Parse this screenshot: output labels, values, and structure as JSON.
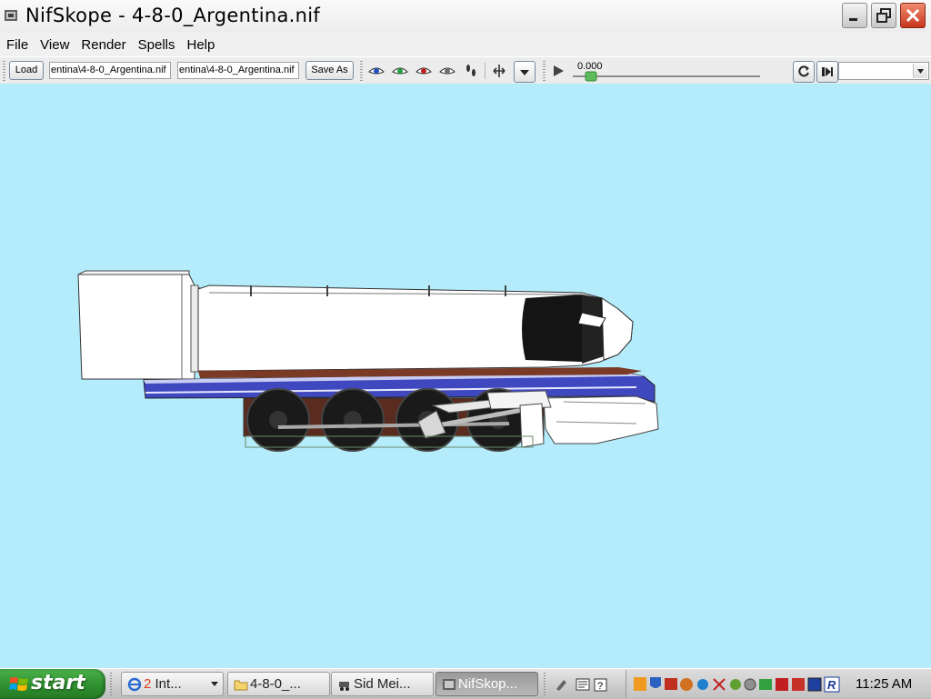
{
  "window": {
    "title": "NifSkope - 4-8-0_Argentina.nif"
  },
  "menu": {
    "items": [
      "File",
      "View",
      "Render",
      "Spells",
      "Help"
    ]
  },
  "toolbar": {
    "load_label": "Load",
    "load_path": "entina\\4-8-0_Argentina.nif",
    "save_path": "entina\\4-8-0_Argentina.nif",
    "save_as_label": "Save As",
    "time_value": "0.000",
    "anim_select_value": ""
  },
  "taskbar": {
    "start_label": "start",
    "buttons": [
      {
        "label": "2 Int...",
        "prefix": "2",
        "rest": " Int..."
      },
      {
        "label": "4-8-0_..."
      },
      {
        "label": "Sid Mei..."
      },
      {
        "label": "NifSkop..."
      }
    ],
    "clock": "11:25 AM"
  },
  "colors": {
    "viewport_bg": "#b4ecfc",
    "start_green": "#2e8d2e",
    "close_red": "#c7351b"
  }
}
